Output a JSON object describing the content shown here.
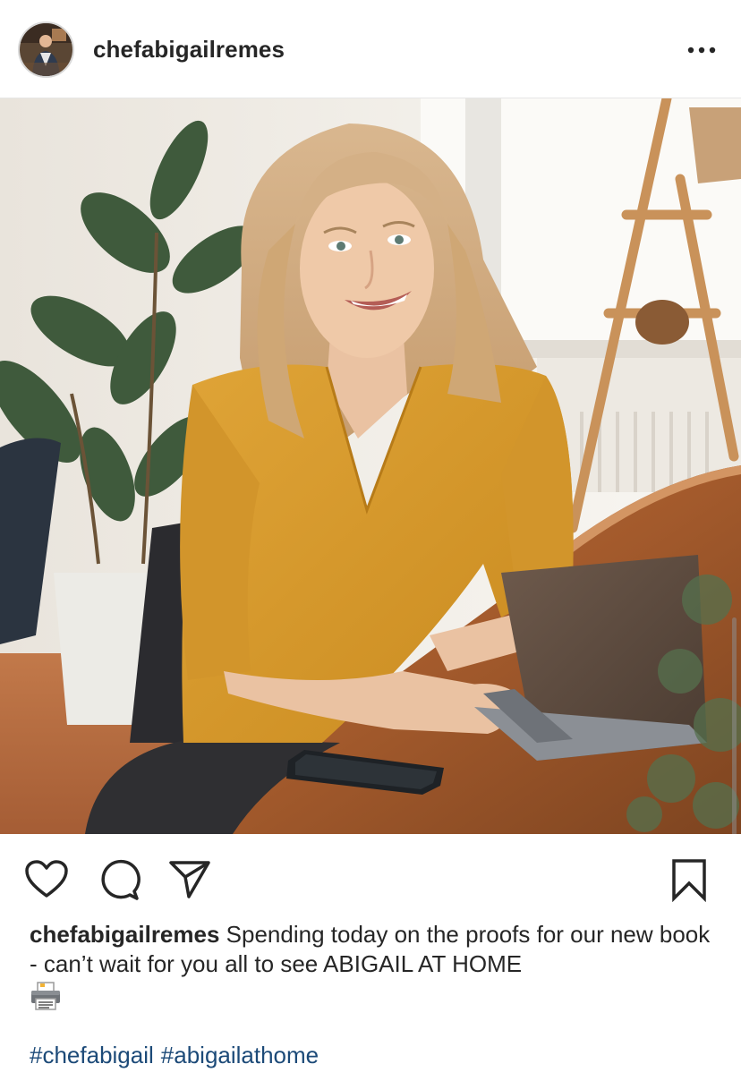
{
  "post": {
    "username": "chefabigailremes",
    "more_icon": "more-horizontal-icon",
    "avatar_icon": "profile-avatar",
    "photo_description_icon": "post-photo"
  },
  "actions": {
    "like_icon": "heart-icon",
    "comment_icon": "comment-bubble-icon",
    "share_icon": "paper-plane-icon",
    "save_icon": "bookmark-icon"
  },
  "caption": {
    "username": "chefabigailremes",
    "text": "Spending today on the proofs for our new book - can’t wait for you all to see ABIGAIL AT HOME",
    "emoji_icon": "printer-emoji-icon"
  },
  "hashtags": [
    "#chefabigail",
    "#abigailathome"
  ],
  "colors": {
    "text": "#262626",
    "hashtag": "#1c4a78",
    "divider": "#e6e6e6",
    "shirt": "#d79b2a"
  }
}
